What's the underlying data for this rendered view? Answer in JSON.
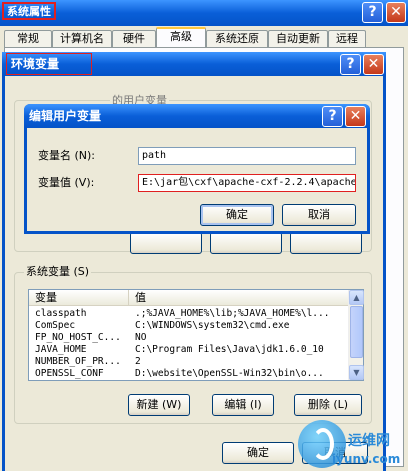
{
  "system_properties": {
    "title": "系统属性",
    "help_button": "?",
    "close_button": "✕",
    "tabs": [
      {
        "label": "常规"
      },
      {
        "label": "计算机名"
      },
      {
        "label": "硬件"
      },
      {
        "label": "高级"
      },
      {
        "label": "系统还原"
      },
      {
        "label": "自动更新"
      },
      {
        "label": "远程"
      }
    ],
    "active_tab": "高级"
  },
  "env_dialog": {
    "title": "环境变量",
    "help_button": "?",
    "close_button": "✕",
    "user_vars_label_partial": "的用户变量",
    "system_vars_label": "系统变量 (S)",
    "columns": {
      "variable": "变量",
      "value": "值"
    },
    "system_vars": [
      {
        "name": "classpath",
        "value": ".;%JAVA_HOME%\\lib;%JAVA_HOME%\\l..."
      },
      {
        "name": "ComSpec",
        "value": "C:\\WINDOWS\\system32\\cmd.exe"
      },
      {
        "name": "FP_NO_HOST_C...",
        "value": "NO"
      },
      {
        "name": "JAVA_HOME",
        "value": "C:\\Program Files\\Java\\jdk1.6.0_10"
      },
      {
        "name": "NUMBER_OF_PR...",
        "value": "2"
      },
      {
        "name": "OPENSSL_CONF",
        "value": "D:\\website\\OpenSSL-Win32\\bin\\o..."
      }
    ],
    "buttons": {
      "new": "新建 (W)",
      "edit": "编辑 (I)",
      "delete": "删除 (L)",
      "ok": "确定",
      "cancel": "取消"
    }
  },
  "edit_dialog": {
    "title": "编辑用户变量",
    "help_button": "?",
    "close_button": "✕",
    "name_label": "变量名 (N):",
    "value_label": "变量值 (V):",
    "name_value": "path",
    "value_value": "E:\\jar包\\cxf\\apache-cxf-2.2.4\\apache",
    "ok": "确定",
    "cancel": "取消"
  },
  "watermark": {
    "brand": "运维网",
    "domain": "iyunv.com"
  }
}
